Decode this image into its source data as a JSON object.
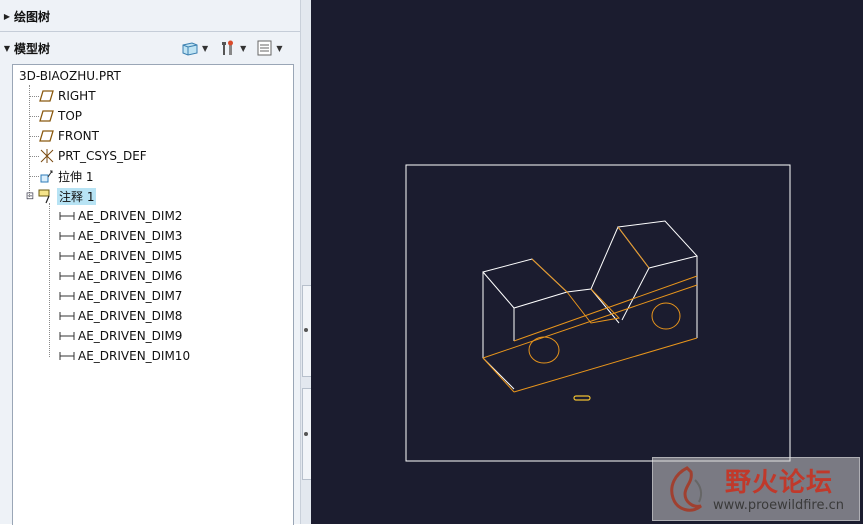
{
  "left_panel": {
    "drawing_tree_label": "绘图树",
    "model_tree_label": "模型树",
    "toolbar": {
      "show_icon": "show-cube-icon",
      "settings_icon": "settings-tools-icon",
      "list_icon": "tree-list-icon"
    }
  },
  "tree": {
    "root": "3D-BIAOZHU.PRT",
    "items": [
      {
        "label": "RIGHT",
        "icon": "datum-plane-icon"
      },
      {
        "label": "TOP",
        "icon": "datum-plane-icon"
      },
      {
        "label": "FRONT",
        "icon": "datum-plane-icon"
      },
      {
        "label": "PRT_CSYS_DEF",
        "icon": "csys-icon"
      },
      {
        "label": "拉伸 1",
        "icon": "extrude-icon"
      },
      {
        "label": "注释 1",
        "icon": "annotation-icon",
        "selected": true
      }
    ],
    "children": [
      "AE_DRIVEN_DIM2",
      "AE_DRIVEN_DIM3",
      "AE_DRIVEN_DIM5",
      "AE_DRIVEN_DIM6",
      "AE_DRIVEN_DIM7",
      "AE_DRIVEN_DIM8",
      "AE_DRIVEN_DIM9",
      "AE_DRIVEN_DIM10"
    ]
  },
  "watermark": {
    "title": "野火论坛",
    "url": "www.proewildfire.cn"
  },
  "colors": {
    "graphics_bg": "#1b1c2f",
    "model_edge": "#ffffff",
    "highlight_edge": "#e8951c",
    "selected_bg": "#b7e3f4"
  }
}
